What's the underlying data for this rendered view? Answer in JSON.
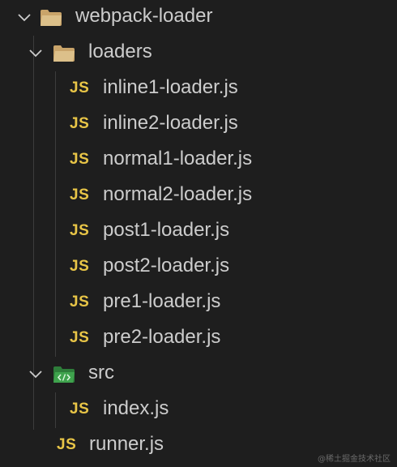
{
  "explorer": {
    "root": {
      "name": "webpack-loader",
      "icon": "folder-open-icon",
      "expanded": true
    },
    "loaders_folder": {
      "name": "loaders",
      "icon": "folder-open-icon",
      "expanded": true,
      "files": [
        {
          "name": "inline1-loader.js",
          "icon": "JS"
        },
        {
          "name": "inline2-loader.js",
          "icon": "JS"
        },
        {
          "name": "normal1-loader.js",
          "icon": "JS"
        },
        {
          "name": "normal2-loader.js",
          "icon": "JS"
        },
        {
          "name": "post1-loader.js",
          "icon": "JS"
        },
        {
          "name": "post2-loader.js",
          "icon": "JS"
        },
        {
          "name": "pre1-loader.js",
          "icon": "JS"
        },
        {
          "name": "pre2-loader.js",
          "icon": "JS"
        }
      ]
    },
    "src_folder": {
      "name": "src",
      "icon": "src-folder-icon",
      "expanded": true,
      "files": [
        {
          "name": "index.js",
          "icon": "JS"
        }
      ]
    },
    "root_files": [
      {
        "name": "runner.js",
        "icon": "JS"
      }
    ]
  },
  "colors": {
    "background": "#1e1e1e",
    "text": "#cccccc",
    "js_icon": "#e8c547",
    "src_folder": "#3fa34d"
  },
  "watermark": "@稀土掘金技术社区"
}
